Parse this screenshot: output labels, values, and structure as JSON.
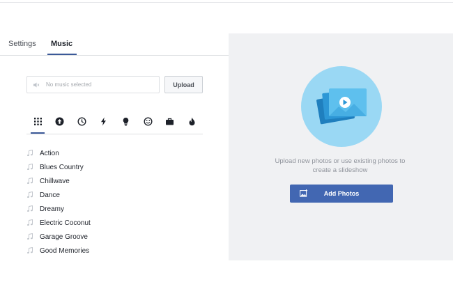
{
  "tabs": [
    {
      "label": "Settings",
      "active": false
    },
    {
      "label": "Music",
      "active": true
    }
  ],
  "music": {
    "placeholder": "No music selected",
    "upload_label": "Upload"
  },
  "categories": [
    {
      "icon": "grid-icon",
      "active": true
    },
    {
      "icon": "arrow-up-circle-icon"
    },
    {
      "icon": "clock-icon"
    },
    {
      "icon": "lightning-icon"
    },
    {
      "icon": "lightbulb-icon"
    },
    {
      "icon": "smiley-icon"
    },
    {
      "icon": "briefcase-icon"
    },
    {
      "icon": "flame-icon"
    }
  ],
  "genres": [
    {
      "name": "Action"
    },
    {
      "name": "Blues Country"
    },
    {
      "name": "Chillwave"
    },
    {
      "name": "Dance"
    },
    {
      "name": "Dreamy"
    },
    {
      "name": "Electric Coconut"
    },
    {
      "name": "Garage Groove"
    },
    {
      "name": "Good Memories"
    }
  ],
  "slideshow": {
    "hint": "Upload new photos or use existing photos to create a slideshow",
    "add_photos_label": "Add Photos"
  },
  "colors": {
    "accent": "#4267b2",
    "hero_circle": "#9ad8f4",
    "panel_bg": "#f0f1f3"
  }
}
